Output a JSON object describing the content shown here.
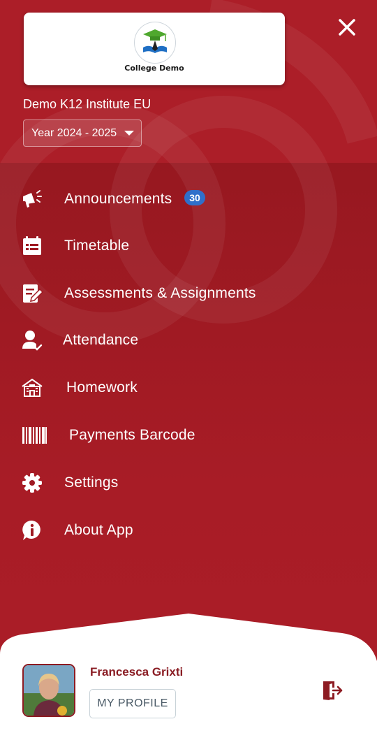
{
  "header": {
    "logo_text": "College Demo",
    "institute_name": "Demo K12 Institute EU",
    "year_selector": {
      "selected": "Year 2024 - 2025"
    },
    "close_icon": "close-icon"
  },
  "menu": {
    "items": [
      {
        "label": "Announcements",
        "icon": "megaphone-icon",
        "badge": "30"
      },
      {
        "label": "Timetable",
        "icon": "calendar-icon"
      },
      {
        "label": "Assessments & Assignments",
        "icon": "edit-document-icon"
      },
      {
        "label": "Attendance",
        "icon": "person-check-icon"
      },
      {
        "label": "Homework",
        "icon": "school-house-icon"
      },
      {
        "label": "Payments Barcode",
        "icon": "barcode-icon"
      },
      {
        "label": "Settings",
        "icon": "gear-icon"
      },
      {
        "label": "About App",
        "icon": "info-bubble-icon"
      }
    ]
  },
  "profile": {
    "name": "Francesca Grixti",
    "button_label": "MY PROFILE",
    "logout_icon": "logout-icon"
  },
  "colors": {
    "brand_red": "#ac1e28",
    "badge_blue": "#2f6fca",
    "name_red": "#8a1d24",
    "logout_red": "#8d1b22"
  }
}
